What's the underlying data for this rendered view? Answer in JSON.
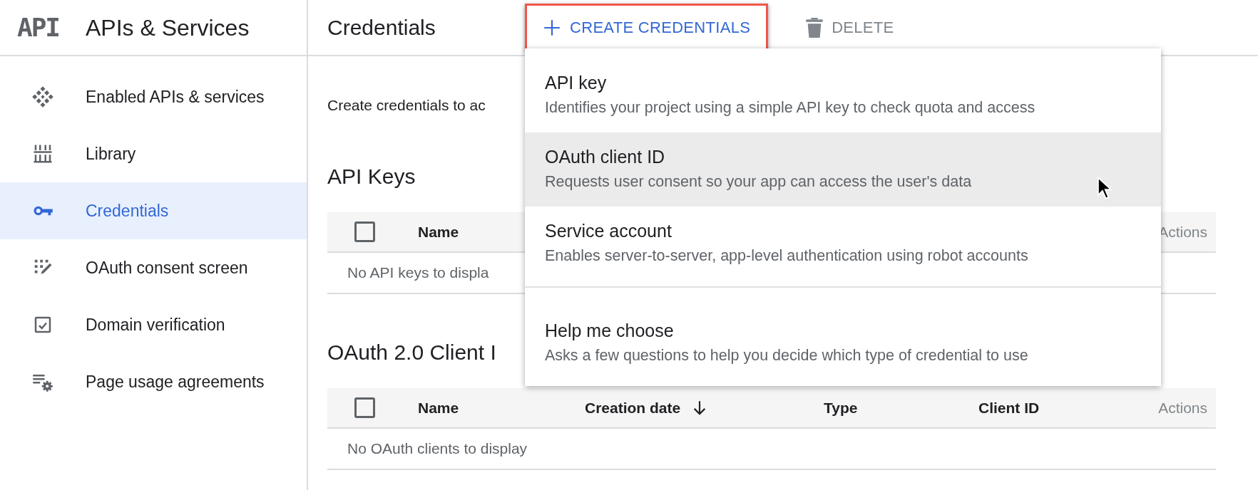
{
  "header": {
    "logo": "API",
    "title": "APIs & Services"
  },
  "sidebar": {
    "items": [
      {
        "label": "Enabled APIs & services",
        "selected": false
      },
      {
        "label": "Library",
        "selected": false
      },
      {
        "label": "Credentials",
        "selected": true
      },
      {
        "label": "OAuth consent screen",
        "selected": false
      },
      {
        "label": "Domain verification",
        "selected": false
      },
      {
        "label": "Page usage agreements",
        "selected": false
      }
    ]
  },
  "toolbar": {
    "title": "Credentials",
    "buttons": [
      {
        "label": "CREATE CREDENTIALS",
        "kind": "create",
        "highlighted": true,
        "disabled": false
      },
      {
        "label": "DELETE",
        "kind": "delete",
        "highlighted": false,
        "disabled": true
      }
    ]
  },
  "intro": "Create credentials to ac",
  "sections": [
    {
      "heading": "API Keys",
      "columns": [
        {
          "label": "Name",
          "kind": "text"
        },
        {
          "label": "Actions",
          "kind": "actions"
        }
      ],
      "checked": false,
      "empty": "No API keys to displa"
    },
    {
      "heading": "OAuth 2.0 Client I",
      "columns": [
        {
          "label": "Name",
          "kind": "text"
        },
        {
          "label": "Creation date",
          "kind": "sort"
        },
        {
          "label": "Type",
          "kind": "text"
        },
        {
          "label": "Client ID",
          "kind": "text"
        },
        {
          "label": "Actions",
          "kind": "actions"
        }
      ],
      "checked": false,
      "empty": "No OAuth clients to display"
    }
  ],
  "menu": {
    "items": [
      {
        "title": "API key",
        "description": "Identifies your project using a simple API key to check quota and access",
        "hovered": false,
        "kind": "option"
      },
      {
        "title": "OAuth client ID",
        "description": "Requests user consent so your app can access the user's data",
        "hovered": true,
        "kind": "option"
      },
      {
        "title": "Service account",
        "description": "Enables server-to-server, app-level authentication using robot accounts",
        "hovered": false,
        "kind": "option"
      },
      {
        "title": "Help me choose",
        "description": "Asks a few questions to help you decide which type of credential to use",
        "hovered": false,
        "kind": "help"
      }
    ]
  }
}
